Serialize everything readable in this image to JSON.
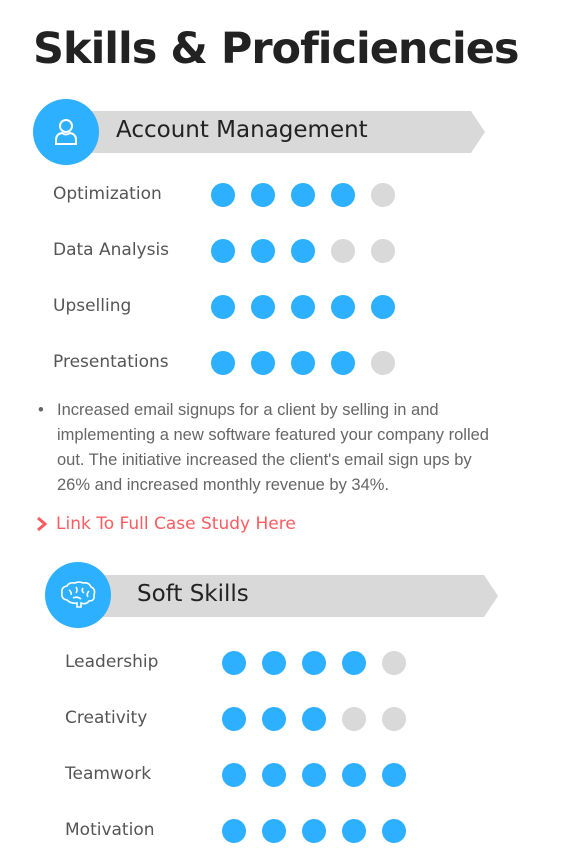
{
  "title": "Skills & Proficiencies",
  "colors": {
    "accent": "#2db0ff",
    "inactive": "#d9d9d9",
    "link": "#ff5a5f",
    "banner": "#d9d9d9"
  },
  "sections": [
    {
      "heading": "Account Management",
      "icon": "user-icon",
      "max_rating": 5,
      "skills": [
        {
          "label": "Optimization",
          "rating": 4
        },
        {
          "label": "Data Analysis",
          "rating": 3
        },
        {
          "label": "Upselling",
          "rating": 5
        },
        {
          "label": "Presentations",
          "rating": 4
        }
      ],
      "bullet": "Increased email signups for a client by selling in and implementing a new software featured your company rolled out. The initiative increased the client's email sign ups by 26% and increased monthly revenue by 34%.",
      "link": "Link To Full Case Study Here"
    },
    {
      "heading": "Soft Skills",
      "icon": "brain-icon",
      "max_rating": 5,
      "skills": [
        {
          "label": "Leadership",
          "rating": 4
        },
        {
          "label": "Creativity",
          "rating": 3
        },
        {
          "label": "Teamwork",
          "rating": 5
        },
        {
          "label": "Motivation",
          "rating": 5
        }
      ]
    }
  ]
}
